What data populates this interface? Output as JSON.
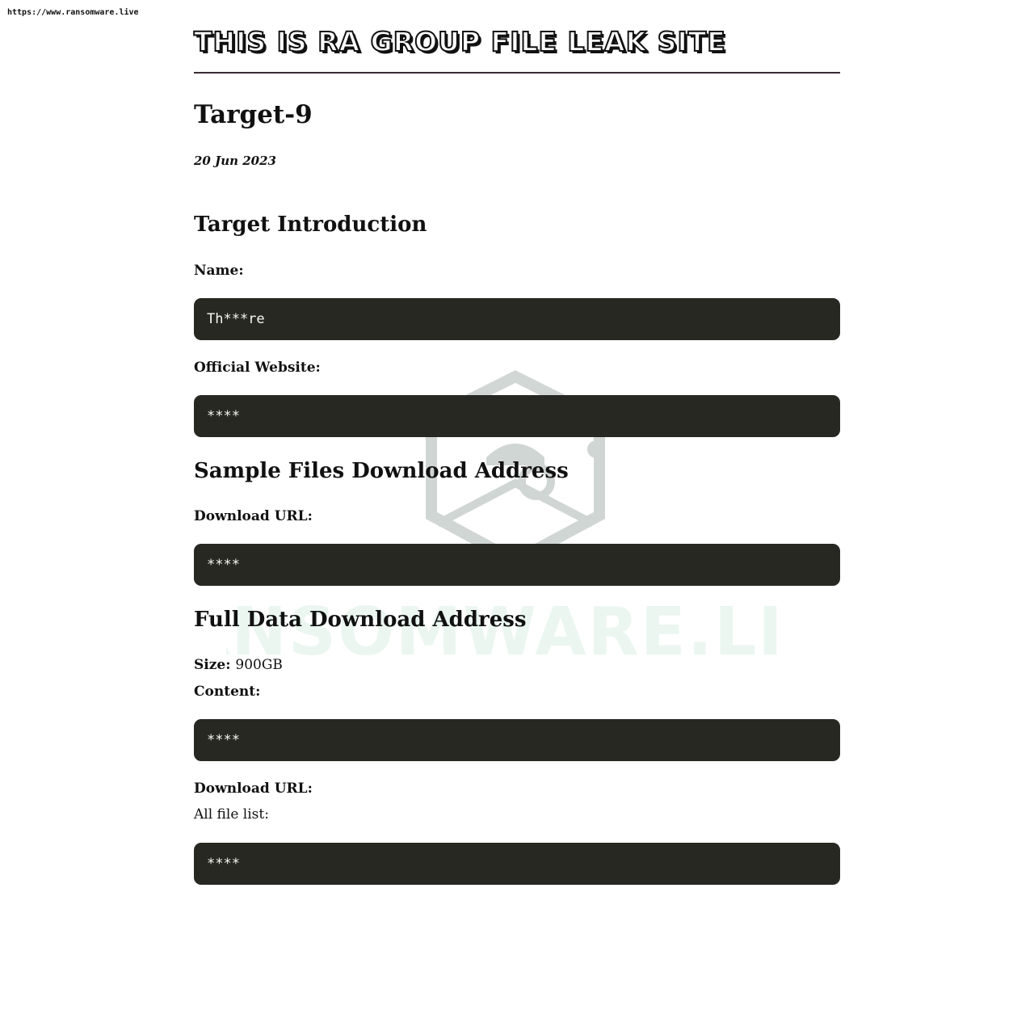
{
  "source_url": "https://www.ransomware.live",
  "watermark_text": "RANSOMWARE.LIVE",
  "site": {
    "title": "THIS IS RA GROUP FILE LEAK SITE"
  },
  "post": {
    "title": "Target-9",
    "date": "20 Jun 2023"
  },
  "target_intro": {
    "heading": "Target Introduction",
    "name_label": "Name:",
    "name_value": "Th***re",
    "website_label": "Official Website:",
    "website_value": "****"
  },
  "sample_files": {
    "heading": "Sample Files Download Address",
    "url_label": "Download URL:",
    "url_value": "****"
  },
  "full_data": {
    "heading": "Full Data Download Address",
    "size_label": "Size:",
    "size_value": "900GB",
    "content_label": "Content:",
    "content_value": "****",
    "url_label": "Download URL:",
    "file_list_label": "All file list:",
    "file_list_value": "****"
  }
}
